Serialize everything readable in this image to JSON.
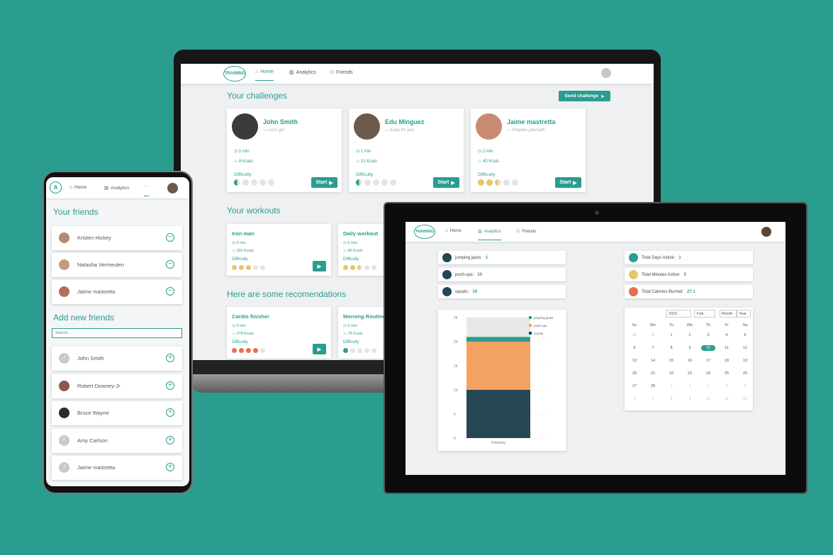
{
  "colors": {
    "accent": "#2a9d8f",
    "orange": "#f4a261",
    "dark": "#264653",
    "gold": "#e9c46a",
    "red": "#e76f51"
  },
  "laptop": {
    "logo": "TRAINING",
    "nav": {
      "home": "Home",
      "analytics": "Analytics",
      "friends": "Friends"
    },
    "challenges_title": "Your challenges",
    "send_challenge": "Send challenge",
    "challenges": [
      {
        "name": "John Smith",
        "message": "— Let's go!",
        "time": "1 min",
        "kcal": "8 Kcals",
        "difficulty_label": "Difficulty",
        "difficulty": 0.5,
        "start": "Start"
      },
      {
        "name": "Edu Minguez",
        "message": "— Easy for you",
        "time": "1 min",
        "kcal": "21 Kcals",
        "difficulty_label": "Difficulty",
        "difficulty": 0.5,
        "start": "Start"
      },
      {
        "name": "Jaime mastretta",
        "message": "— Prepare yourself!",
        "time": "2 min",
        "kcal": "40 Kcals",
        "difficulty_label": "Difficulty",
        "difficulty": 2.5,
        "start": "Start"
      }
    ],
    "workouts_title": "Your workouts",
    "workouts": [
      {
        "name": "Iron man",
        "time": "6 min",
        "kcal": "232 Kcals",
        "difficulty_label": "Difficulty",
        "difficulty": 3
      },
      {
        "name": "Daily workout",
        "time": "6 min",
        "kcal": "80 Kcals",
        "difficulty_label": "Difficulty",
        "difficulty": 2.5
      }
    ],
    "reco_title": "Here are some recomendations",
    "recommendations": [
      {
        "name": "Cardio finisher",
        "time": "9 min",
        "kcal": "278 Kcals",
        "difficulty_label": "Difficulty",
        "difficulty": 4
      },
      {
        "name": "Morning Routine",
        "time": "5 min",
        "kcal": "78 Kcals",
        "difficulty_label": "Difficulty",
        "difficulty": 1
      }
    ]
  },
  "tablet": {
    "logo": "TRAINING",
    "nav": {
      "home": "Home",
      "analytics": "Analytics",
      "friends": "Friends"
    },
    "exercises": [
      {
        "label": "jumping jacks:",
        "value": "1"
      },
      {
        "label": "push-ups:",
        "value": "10"
      },
      {
        "label": "squats:",
        "value": "16"
      }
    ],
    "stats": [
      {
        "label": "Total Days Active:",
        "value": "1"
      },
      {
        "label": "Total Minutes Active:",
        "value": "5"
      },
      {
        "label": "Total Calories Burned:",
        "value": "27.1"
      }
    ],
    "calendar": {
      "year": "2022",
      "month": "Feb",
      "view_month": "Month",
      "view_year": "Year",
      "weekdays": [
        "Su",
        "Mo",
        "Tu",
        "We",
        "Th",
        "Fr",
        "Sa"
      ],
      "weeks": [
        [
          "30",
          "31",
          "1",
          "2",
          "3",
          "4",
          "5"
        ],
        [
          "6",
          "7",
          "8",
          "9",
          "10",
          "11",
          "12"
        ],
        [
          "13",
          "14",
          "15",
          "16",
          "17",
          "18",
          "19"
        ],
        [
          "20",
          "21",
          "22",
          "23",
          "24",
          "25",
          "26"
        ],
        [
          "27",
          "28",
          "1",
          "2",
          "3",
          "4",
          "5"
        ],
        [
          "6",
          "7",
          "8",
          "9",
          "10",
          "11",
          "12"
        ]
      ],
      "selected": "10"
    }
  },
  "chart_data": {
    "type": "bar",
    "categories": [
      "February"
    ],
    "series": [
      {
        "name": "jumping jacks",
        "values": [
          1
        ]
      },
      {
        "name": "push-ups",
        "values": [
          10
        ]
      },
      {
        "name": "squats",
        "values": [
          10
        ]
      }
    ],
    "yticks": [
      "0",
      "5",
      "10",
      "15",
      "20",
      "25"
    ],
    "ylim": [
      0,
      25
    ],
    "legend": "top-right",
    "title": "",
    "xlabel": "",
    "ylabel": ""
  },
  "phone": {
    "nav": {
      "home": "Home",
      "analytics": "Analytics",
      "more": "···"
    },
    "friends_title": "Your friends",
    "friends": [
      "Kristen Hickey",
      "Natasha Vermeulen",
      "Jaime mastretta"
    ],
    "add_title": "Add new friends",
    "search_placeholder": "Search...",
    "suggestions": [
      {
        "name": "John Smith",
        "initial": "J"
      },
      {
        "name": "Robert Downey-Jr",
        "initial": ""
      },
      {
        "name": "Bruce Wayne",
        "initial": ""
      },
      {
        "name": "Amy Carlson",
        "initial": "A"
      },
      {
        "name": "Jaime mastretta",
        "initial": "J"
      }
    ]
  }
}
